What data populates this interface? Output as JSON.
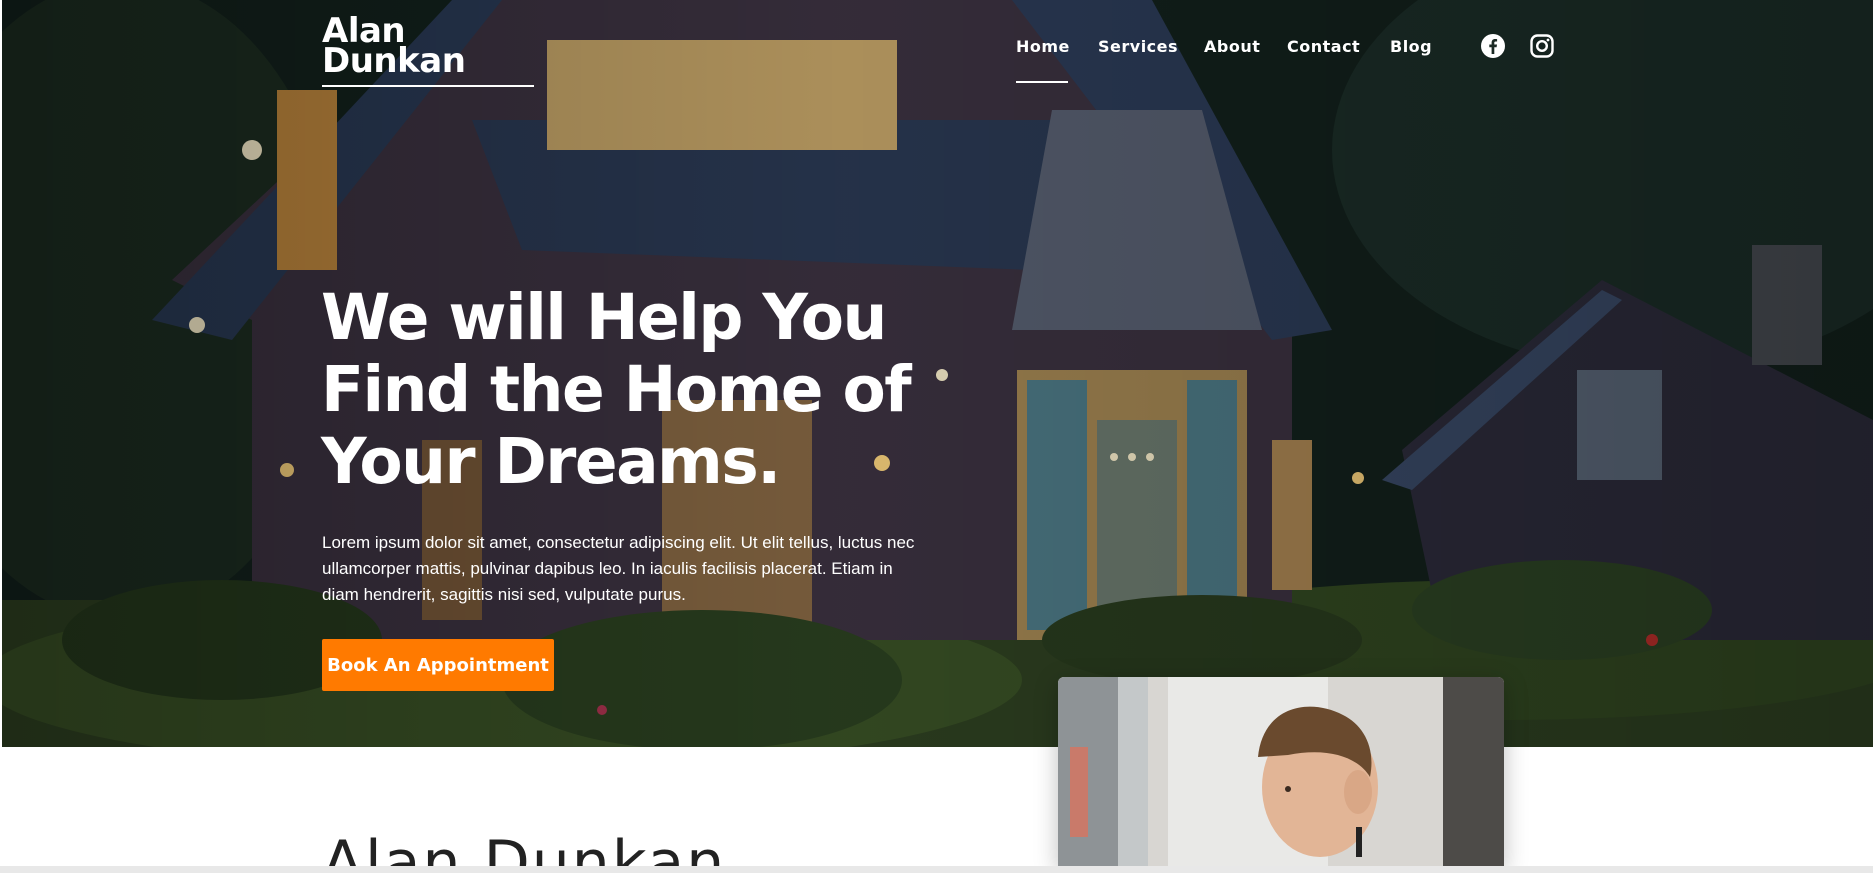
{
  "header": {
    "logo_line1": "Alan",
    "logo_line2": "Dunkan",
    "nav": [
      {
        "label": "Home",
        "active": true
      },
      {
        "label": "Services"
      },
      {
        "label": "About"
      },
      {
        "label": "Contact"
      },
      {
        "label": "Blog"
      }
    ],
    "social": [
      "facebook-icon",
      "instagram-icon"
    ]
  },
  "hero": {
    "headline_line1": "We will Help You",
    "headline_line2": "Find the Home of",
    "headline_line3": "Your Dreams.",
    "lead": "Lorem ipsum dolor sit amet, consectetur adipiscing elit. Ut elit tellus, luctus nec ullamcorper mattis, pulvinar dapibus leo. In iaculis facilisis placerat. Etiam in diam hendrerit, sagittis nisi sed, vulputate purus.",
    "cta_label": "Book An Appointment"
  },
  "about": {
    "name_heading": "Alan Dunkan"
  },
  "colors": {
    "accent": "#ff7a00",
    "nav_text": "#ffffff"
  }
}
